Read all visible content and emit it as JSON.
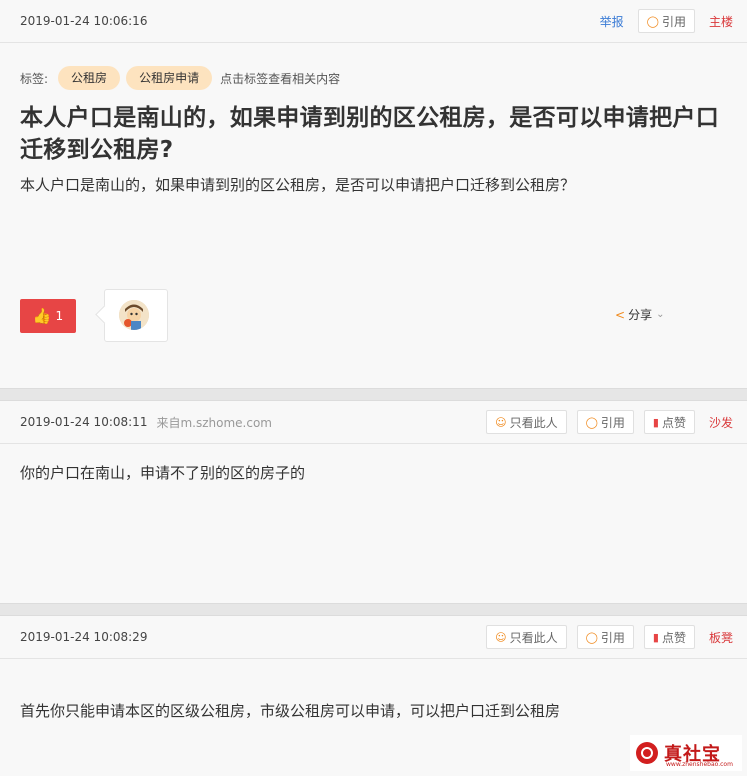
{
  "op": {
    "time": "2019-01-24 10:06:16",
    "report": "举报",
    "quote": "引用",
    "floor": "主楼",
    "tags_label": "标签:",
    "tags": [
      "公租房",
      "公租房申请"
    ],
    "tags_hint": "点击标签查看相关内容",
    "title": "本人户口是南山的，如果申请到别的区公租房，是否可以申请把户口迁移到公租房?",
    "content": "本人户口是南山的，如果申请到别的区公租房，是否可以申请把户口迁移到公租房？",
    "like_count": "1",
    "share": "分享"
  },
  "replies": [
    {
      "time": "2019-01-24 10:08:11",
      "source": "来自m.szhome.com",
      "only_this": "只看此人",
      "quote": "引用",
      "like": "点赞",
      "floor": "沙发",
      "content": "你的户口在南山，申请不了别的区的房子的"
    },
    {
      "time": "2019-01-24 10:08:29",
      "source": "",
      "only_this": "只看此人",
      "quote": "引用",
      "like": "点赞",
      "floor": "板凳",
      "content": "首先你只能申请本区的区级公租房，市级公租房可以申请，可以把户口迁到公租房"
    }
  ],
  "watermark": {
    "name": "真社宝",
    "url": "www.zhenshebao.com"
  },
  "colors": {
    "accent_red": "#e74545",
    "tag_bg": "#fde3bf",
    "link_blue": "#3a7bd5",
    "floor_red": "#d9383a"
  }
}
